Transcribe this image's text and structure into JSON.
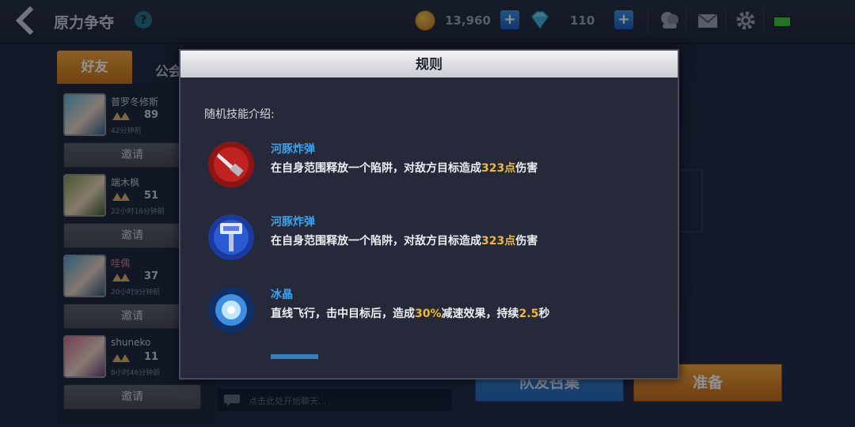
{
  "header": {
    "title": "原力争夺",
    "help": "?",
    "coins": "13,960",
    "gems": "110",
    "plus": "+"
  },
  "tabs": {
    "friends": "好友",
    "guild": "公会"
  },
  "friends": [
    {
      "name": "普罗冬修斯",
      "level": "89",
      "time": "42分钟前",
      "invite": "邀请"
    },
    {
      "name": "端木枫",
      "level": "51",
      "time": "22小时16分钟前",
      "invite": "邀请"
    },
    {
      "name": "哇偶",
      "level": "37",
      "time": "20小时9分钟前",
      "invite": "邀请"
    },
    {
      "name": "shuneko",
      "level": "11",
      "time": "8小时46分钟前",
      "invite": "邀请"
    }
  ],
  "chat": {
    "placeholder": "点击此处开始聊天..."
  },
  "buttons": {
    "summon": "队友召集",
    "ready": "准备"
  },
  "modal": {
    "title": "规则",
    "intro": "随机技能介绍:",
    "skills": [
      {
        "name": "河豚炸弹",
        "desc_pre": "在自身范围释放一个陷阱，对敌方目标造成",
        "highlight": "323点",
        "desc_post": "伤害"
      },
      {
        "name": "河豚炸弹",
        "desc_pre": "在自身范围释放一个陷阱，对敌方目标造成",
        "highlight": "323点",
        "desc_post": "伤害"
      },
      {
        "name": "冰晶",
        "desc_pre": "直线飞行，击中目标后，造成",
        "highlight": "30%",
        "desc_mid": "减速效果，持续",
        "highlight2": "2.5",
        "desc_post": "秒"
      }
    ]
  },
  "colors": {
    "accent_orange": "#f5a334",
    "accent_blue": "#3aa3f0",
    "highlight": "#f3b92d"
  }
}
